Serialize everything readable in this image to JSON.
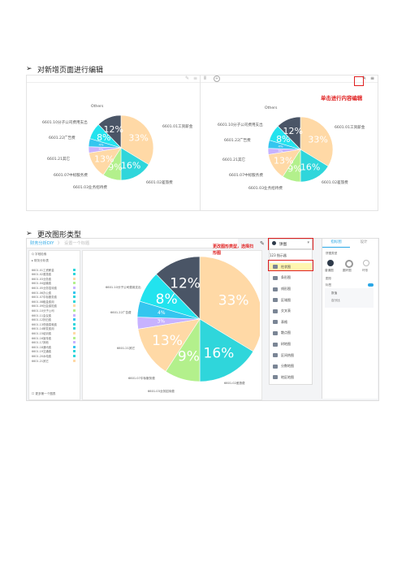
{
  "section1": {
    "bullet": "➢",
    "heading": "对新增页面进行编辑"
  },
  "section2": {
    "bullet": "➢",
    "heading": "更改图形类型"
  },
  "annotations": {
    "edit": "单击进行内容编辑",
    "change_line1": "更改图形类型，选择扫",
    "change_line2": "形图"
  },
  "pie": {
    "colors": [
      "#ffd9a6",
      "#2fd6db",
      "#b7f58f",
      "#b5a3ff",
      "#3cc9ff",
      "#22e0ea",
      "#4a5566"
    ],
    "slice_names": [
      "6601.01工资薪金",
      "6601.02差旅费",
      "6601.03业务招待费",
      "6601.07中标服务费",
      "6601.21其它",
      "6601.22广告费",
      "6601.10分子公司费用支出",
      "Others"
    ],
    "pcts": [
      33,
      16,
      9,
      13,
      3,
      4,
      8,
      12
    ],
    "colors_ordered": [
      "#ffd9a6",
      "#2fd6db",
      "#b3f08c",
      "#ffd9a6",
      "#c7b2ff",
      "#34c6ef",
      "#22e3ee",
      "#4a5566"
    ]
  },
  "app": {
    "breadcrumb_root": "财务分析DIY",
    "breadcrumb_sep": "〉",
    "breadcrumb_page": "设置一个标题",
    "left_search": "Q 字段检索",
    "left_group": "▸ 财务分析表",
    "fields": [
      "6601.01工资薪金",
      "6601.02差旅费",
      "6601.03业务费",
      "6601.04运输费",
      "6601.05业务招待费",
      "6601.06办公费",
      "6601.07中标服务费",
      "6601.08租金费用",
      "6601.09社会保险费",
      "6601.10分子公司",
      "6601.11会议费",
      "6601.12折旧费",
      "6601.13低值易耗费",
      "6601.14研发费用",
      "6601.15培训费",
      "6601.16宣传费",
      "6601.17其他",
      "6601.18通讯费",
      "6601.19交通费",
      "6601.20水电费",
      "6601.21其它"
    ],
    "left_footer": "☐ 更多第一个图表",
    "chart_type_selected": "饼图",
    "menu_items": [
      "123 指示器",
      "柱状图",
      "条形图",
      "线形图",
      "区域图",
      "交叉表",
      "表格",
      "散点图",
      "树地图",
      "区间热图",
      "分数地图",
      "地区地图"
    ],
    "right_tabs": [
      "指标图",
      "设计"
    ],
    "right_section": "饼图类型",
    "right_types": [
      "普通图",
      "圆环图",
      "环形"
    ],
    "right_labels": [
      "图形",
      "标签",
      "数值",
      "百分比"
    ]
  }
}
